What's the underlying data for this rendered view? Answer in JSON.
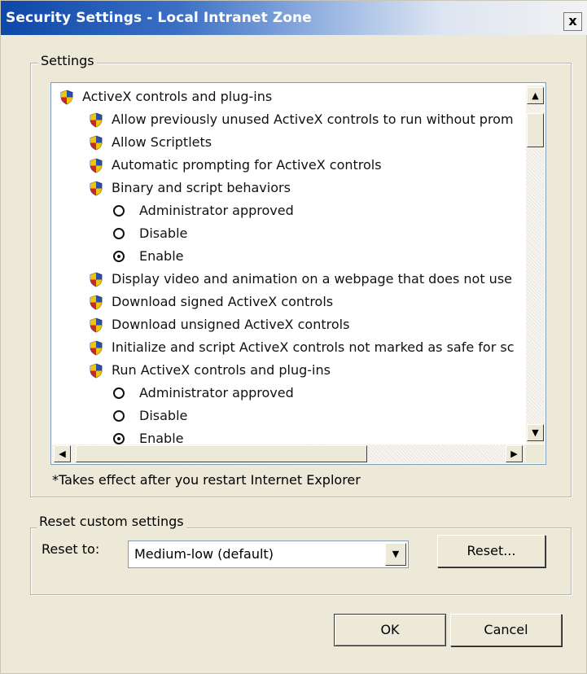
{
  "window": {
    "title": "Security Settings - Local Intranet Zone",
    "close_label": "x"
  },
  "settings_group": {
    "legend": "Settings",
    "tree": [
      {
        "type": "category",
        "label": "ActiveX controls and plug-ins"
      },
      {
        "type": "item",
        "label": "Allow previously unused ActiveX controls to run without prom"
      },
      {
        "type": "item",
        "label": "Allow Scriptlets"
      },
      {
        "type": "item",
        "label": "Automatic prompting for ActiveX controls"
      },
      {
        "type": "item",
        "label": "Binary and script behaviors"
      },
      {
        "type": "option",
        "label": "Administrator approved",
        "checked": false
      },
      {
        "type": "option",
        "label": "Disable",
        "checked": false
      },
      {
        "type": "option",
        "label": "Enable",
        "checked": true
      },
      {
        "type": "item",
        "label": "Display video and animation on a webpage that does not use"
      },
      {
        "type": "item",
        "label": "Download signed ActiveX controls"
      },
      {
        "type": "item",
        "label": "Download unsigned ActiveX controls"
      },
      {
        "type": "item",
        "label": "Initialize and script ActiveX controls not marked as safe for sc"
      },
      {
        "type": "item",
        "label": "Run ActiveX controls and plug-ins"
      },
      {
        "type": "option",
        "label": "Administrator approved",
        "checked": false
      },
      {
        "type": "option",
        "label": "Disable",
        "checked": false
      },
      {
        "type": "option",
        "label": "Enable",
        "checked": true
      }
    ],
    "note": "*Takes effect after you restart Internet Explorer"
  },
  "reset_group": {
    "legend": "Reset custom settings",
    "reset_to_label": "Reset to:",
    "reset_to_value": "Medium-low (default)",
    "reset_button": "Reset..."
  },
  "buttons": {
    "ok": "OK",
    "cancel": "Cancel"
  },
  "colors": {
    "title_start": "#0d47a8",
    "shield_blue": "#2a4fa8",
    "shield_yellow": "#f5c400",
    "shield_red": "#c8282c"
  }
}
